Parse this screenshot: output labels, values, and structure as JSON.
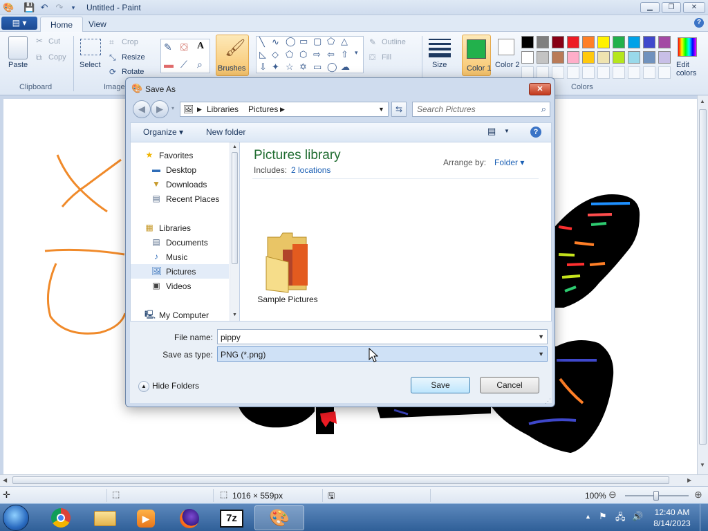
{
  "window": {
    "title": "Untitled - Paint"
  },
  "tabs": {
    "menu_glyph": "▤ ▾",
    "home": "Home",
    "view": "View",
    "help": "?"
  },
  "ribbon": {
    "clipboard": {
      "paste": "Paste",
      "cut": "Cut",
      "copy": "Copy",
      "group": "Clipboard"
    },
    "image": {
      "select": "Select",
      "crop": "Crop",
      "resize": "Resize",
      "rotate": "Rotate",
      "group": "Image"
    },
    "tools": {
      "brushes": "Brushes"
    },
    "shapes": {
      "outline": "Outline",
      "fill": "Fill"
    },
    "size": {
      "label": "Size"
    },
    "colors": {
      "color1": "Color 1",
      "color2": "Color 2",
      "edit": "Edit colors",
      "group": "Colors",
      "color1_value": "#22b14c",
      "row1": [
        "#000000",
        "#7f7f7f",
        "#880015",
        "#ed1c24",
        "#ff7f27",
        "#fff200",
        "#22b14c",
        "#00a2e8",
        "#3f48cc",
        "#a349a4"
      ],
      "row2": [
        "#ffffff",
        "#c3c3c3",
        "#b97a57",
        "#ffaec9",
        "#ffc90e",
        "#efe4b0",
        "#b5e61d",
        "#99d9ea",
        "#7092be",
        "#c8bfe7"
      ]
    }
  },
  "dialog": {
    "title": "Save As",
    "close_glyph": "✕",
    "address": {
      "root": "Libraries",
      "current": "Pictures"
    },
    "search_placeholder": "Search Pictures",
    "organize": "Organize ▾",
    "new_folder": "New folder",
    "nav": {
      "favorites": "Favorites",
      "desktop": "Desktop",
      "downloads": "Downloads",
      "recent": "Recent Places",
      "libraries": "Libraries",
      "documents": "Documents",
      "music": "Music",
      "pictures": "Pictures",
      "videos": "Videos",
      "computer": "My Computer"
    },
    "library": {
      "title": "Pictures library",
      "includes_label": "Includes:",
      "locations": "2 locations",
      "arrange_label": "Arrange by:",
      "arrange_value": "Folder ▾",
      "folder_name": "Sample Pictures"
    },
    "form": {
      "file_name_label": "File name:",
      "file_name_value": "pippy",
      "save_type_label": "Save as type:",
      "save_type_value": "PNG (*.png)",
      "hide_folders": "Hide Folders",
      "save": "Save",
      "cancel": "Cancel"
    }
  },
  "statusbar": {
    "dimensions": "1016 × 559px",
    "zoom": "100%"
  },
  "taskbar": {
    "time": "12:40 AM",
    "date": "8/14/2023",
    "apps": [
      "chrome",
      "explorer",
      "media-player",
      "firefox",
      "7-zip",
      "paint"
    ]
  }
}
